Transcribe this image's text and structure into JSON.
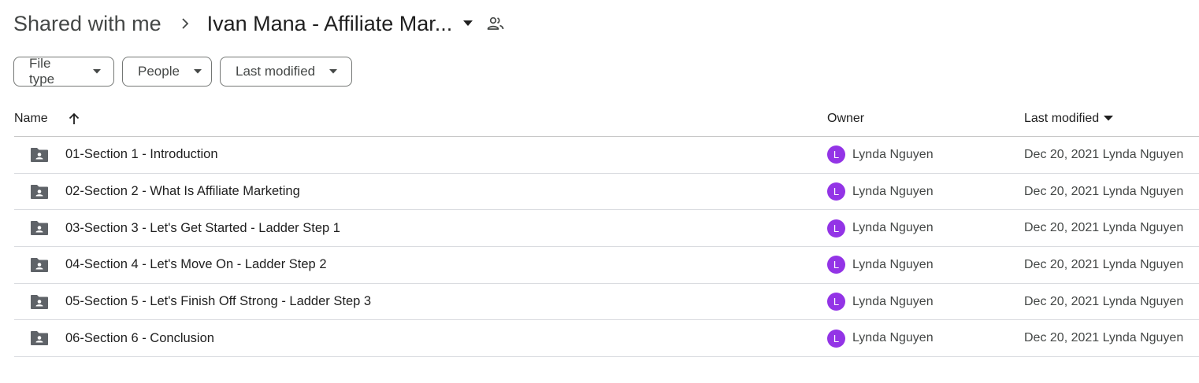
{
  "breadcrumb": {
    "root": "Shared with me",
    "current": "Ivan Mana - Affiliate Mar..."
  },
  "filters": {
    "file_type": "File type",
    "people": "People",
    "last_modified": "Last modified"
  },
  "table": {
    "headers": {
      "name": "Name",
      "owner": "Owner",
      "last_modified": "Last modified"
    },
    "rows": [
      {
        "name": "01-Section 1 - Introduction",
        "owner_initial": "L",
        "owner": "Lynda Nguyen",
        "modified": "Dec 20, 2021 Lynda Nguyen"
      },
      {
        "name": "02-Section 2 - What Is Affiliate Marketing",
        "owner_initial": "L",
        "owner": "Lynda Nguyen",
        "modified": "Dec 20, 2021 Lynda Nguyen"
      },
      {
        "name": "03-Section 3 - Let's Get Started - Ladder Step 1",
        "owner_initial": "L",
        "owner": "Lynda Nguyen",
        "modified": "Dec 20, 2021 Lynda Nguyen"
      },
      {
        "name": "04-Section 4 - Let's Move On - Ladder Step 2",
        "owner_initial": "L",
        "owner": "Lynda Nguyen",
        "modified": "Dec 20, 2021 Lynda Nguyen"
      },
      {
        "name": "05-Section 5 - Let's Finish Off Strong - Ladder Step 3",
        "owner_initial": "L",
        "owner": "Lynda Nguyen",
        "modified": "Dec 20, 2021 Lynda Nguyen"
      },
      {
        "name": "06-Section 6 - Conclusion",
        "owner_initial": "L",
        "owner": "Lynda Nguyen",
        "modified": "Dec 20, 2021 Lynda Nguyen"
      }
    ]
  },
  "icons": {
    "breadcrumb_separator": "chevron-right-icon",
    "folder_menu": "caret-down-icon",
    "shared": "people-icon",
    "sort": "arrow-up-icon",
    "row": "shared-folder-icon"
  },
  "colors": {
    "avatar": "#9334e6",
    "text_primary": "#1f1f1f",
    "text_secondary": "#444746"
  }
}
